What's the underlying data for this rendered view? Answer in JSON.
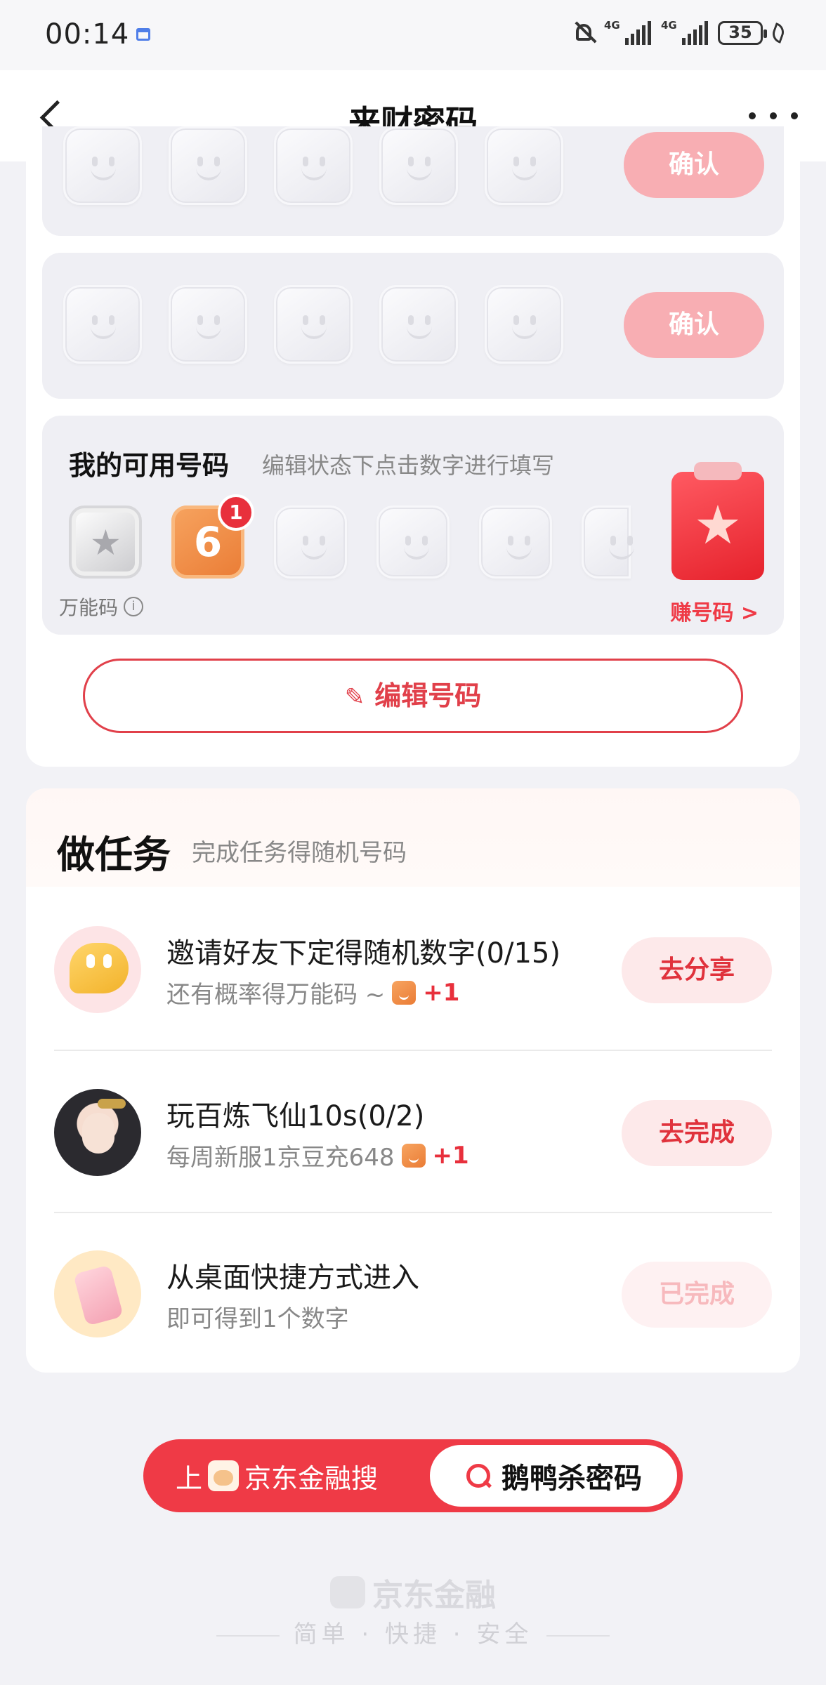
{
  "status_bar": {
    "time": "00:14",
    "network_1": "4G",
    "network_2": "4G",
    "battery": "35"
  },
  "nav": {
    "title": "来财密码"
  },
  "guess_rows": [
    {
      "confirm_label": "确认"
    },
    {
      "confirm_label": "确认"
    }
  ],
  "available": {
    "title": "我的可用号码",
    "hint": "编辑状态下点击数字进行填写",
    "wild_label": "万能码",
    "info_icon": "i",
    "number_value": "6",
    "number_badge": "1",
    "earn_label": "赚号码 >"
  },
  "edit_button": {
    "label": "编辑号码"
  },
  "tasks": {
    "title": "做任务",
    "subtitle": "完成任务得随机号码",
    "items": [
      {
        "title": "邀请好友下定得随机数字(0/15)",
        "desc": "还有概率得万能码 ~",
        "reward": "+1",
        "action": "去分享",
        "icon": "chat-bubble-icon"
      },
      {
        "title": "玩百炼飞仙10s(0/2)",
        "desc": "每周新服1京豆充648",
        "reward": "+1",
        "action": "去完成",
        "icon": "game-avatar"
      },
      {
        "title": "从桌面快捷方式进入",
        "desc": "即可得到1个数字",
        "action": "已完成",
        "icon": "phone-hand-icon"
      }
    ]
  },
  "search_pill": {
    "prefix": "上",
    "app_name": "京东金融搜",
    "query": "鹅鸭杀密码"
  },
  "footer": {
    "brand": "京东金融",
    "slogan": "简单 · 快捷 · 安全"
  },
  "colors": {
    "accent": "#ef3a46",
    "confirm_disabled": "#f8aeb3",
    "page_bg": "#f2f2f6"
  }
}
